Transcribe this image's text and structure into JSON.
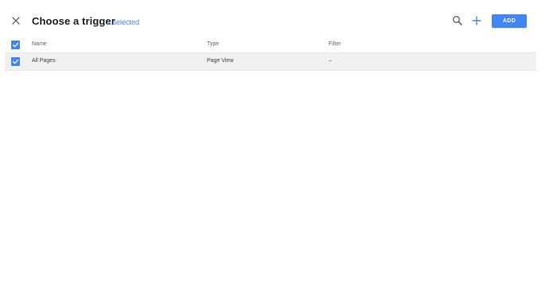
{
  "header": {
    "title": "Choose a trigger",
    "selected_count": "1 selected",
    "add_label": "ADD"
  },
  "table": {
    "columns": [
      "Name",
      "Type",
      "Filter"
    ],
    "rows": [
      {
        "name": "All Pages",
        "type": "Page View",
        "filter": "–",
        "checked": true
      }
    ]
  },
  "icons": {
    "close": "close-icon",
    "search": "search-icon",
    "add": "plus-icon",
    "checkbox": "checkmark-icon"
  },
  "colors": {
    "accent": "#4285f4",
    "selected_row": "#f1f1f1"
  }
}
